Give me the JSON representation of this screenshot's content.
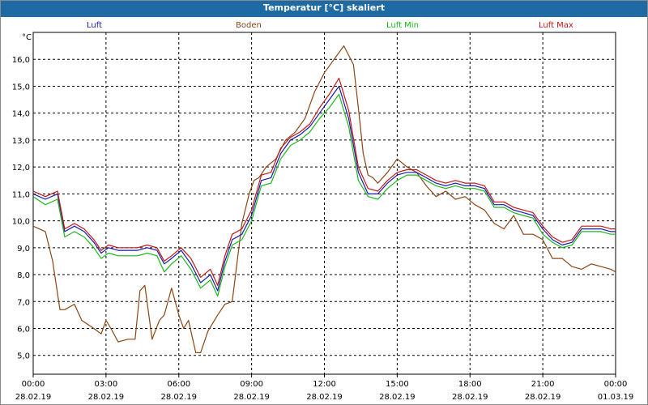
{
  "chart_data": {
    "type": "line",
    "title": "Temperatur [°C] skaliert",
    "ylabel": "°C",
    "ylim": [
      4.3,
      17.0
    ],
    "xlim": [
      0,
      24
    ],
    "grid": true,
    "legend_placement": "top",
    "y_ticks": [
      "5,0",
      "6,0",
      "7,0",
      "8,0",
      "9,0",
      "10,0",
      "11,0",
      "12,0",
      "13,0",
      "14,0",
      "15,0",
      "16,0"
    ],
    "x_ticks": [
      {
        "time": "00:00",
        "date": "28.02.19"
      },
      {
        "time": "03:00",
        "date": "28.02.19"
      },
      {
        "time": "06:00",
        "date": "28.02.19"
      },
      {
        "time": "09:00",
        "date": "28.02.19"
      },
      {
        "time": "12:00",
        "date": "28.02.19"
      },
      {
        "time": "15:00",
        "date": "28.02.19"
      },
      {
        "time": "18:00",
        "date": "28.02.19"
      },
      {
        "time": "21:00",
        "date": "28.02.19"
      },
      {
        "time": "00:00",
        "date": "01.03.19"
      }
    ],
    "series": [
      {
        "name": "Luft",
        "color": "#1a1aa8",
        "x": [
          0,
          0.5,
          1,
          1.3,
          1.7,
          2.1,
          2.5,
          2.8,
          3.1,
          3.5,
          3.9,
          4.3,
          4.7,
          5.1,
          5.4,
          5.7,
          6.1,
          6.5,
          6.9,
          7.3,
          7.6,
          7.9,
          8.2,
          8.6,
          9.0,
          9.4,
          9.8,
          10.2,
          10.6,
          11.0,
          11.4,
          11.8,
          12.2,
          12.6,
          13.0,
          13.4,
          13.8,
          14.2,
          14.6,
          15.0,
          15.4,
          15.8,
          16.2,
          16.6,
          17.0,
          17.4,
          17.8,
          18.2,
          18.6,
          19.0,
          19.4,
          19.8,
          20.2,
          20.6,
          21.0,
          21.4,
          21.8,
          22.2,
          22.6,
          23.0,
          23.4,
          23.8,
          24.0
        ],
        "y": [
          11.0,
          10.8,
          11.0,
          9.6,
          9.8,
          9.6,
          9.2,
          8.8,
          9.0,
          8.9,
          8.9,
          8.9,
          9.0,
          8.9,
          8.4,
          8.6,
          8.9,
          8.4,
          7.7,
          8.0,
          7.4,
          8.5,
          9.3,
          9.5,
          10.2,
          11.5,
          11.6,
          12.5,
          13.0,
          13.2,
          13.5,
          14.0,
          14.5,
          15.0,
          13.8,
          11.8,
          11.0,
          11.0,
          11.4,
          11.7,
          11.8,
          11.8,
          11.6,
          11.4,
          11.3,
          11.4,
          11.3,
          11.3,
          11.2,
          10.6,
          10.6,
          10.4,
          10.3,
          10.2,
          9.7,
          9.3,
          9.1,
          9.2,
          9.7,
          9.7,
          9.7,
          9.6,
          9.6
        ]
      },
      {
        "name": "Boden",
        "color": "#8b4513",
        "x": [
          0,
          0.5,
          0.8,
          1.1,
          1.3,
          1.7,
          2.0,
          2.5,
          2.8,
          3.0,
          3.2,
          3.5,
          3.9,
          4.2,
          4.4,
          4.6,
          4.9,
          5.2,
          5.4,
          5.7,
          6.0,
          6.2,
          6.4,
          6.7,
          6.9,
          7.2,
          7.6,
          7.9,
          8.2,
          8.6,
          8.9,
          9.1,
          9.3,
          9.6,
          10.0,
          10.4,
          10.8,
          11.2,
          11.6,
          12.0,
          12.4,
          12.8,
          13.2,
          13.4,
          13.6,
          13.8,
          14.0,
          14.2,
          14.6,
          15.0,
          15.4,
          15.8,
          16.2,
          16.6,
          17.0,
          17.4,
          17.8,
          18.2,
          18.6,
          19.0,
          19.4,
          19.8,
          20.2,
          20.6,
          21.0,
          21.4,
          21.8,
          22.2,
          22.6,
          23.0,
          23.4,
          23.8,
          24.0
        ],
        "y": [
          9.8,
          9.6,
          8.5,
          6.7,
          6.7,
          6.9,
          6.3,
          6.0,
          5.8,
          6.3,
          6.0,
          5.5,
          5.6,
          5.6,
          7.4,
          7.6,
          5.6,
          6.3,
          6.5,
          7.5,
          6.5,
          6.0,
          6.3,
          5.1,
          5.1,
          5.9,
          6.5,
          6.9,
          7.0,
          9.9,
          11.0,
          11.5,
          11.6,
          12.0,
          12.3,
          13.0,
          13.3,
          13.8,
          14.8,
          15.5,
          16.0,
          16.5,
          15.8,
          14.2,
          12.5,
          11.7,
          11.6,
          11.4,
          11.8,
          12.3,
          12.0,
          11.8,
          11.3,
          10.9,
          11.1,
          10.8,
          10.9,
          10.6,
          10.4,
          9.9,
          9.7,
          10.2,
          9.5,
          9.5,
          9.3,
          8.6,
          8.6,
          8.3,
          8.2,
          8.4,
          8.3,
          8.2,
          8.1
        ]
      },
      {
        "name": "Luft Min",
        "color": "#1ab81a",
        "x": [
          0,
          0.5,
          1,
          1.3,
          1.7,
          2.1,
          2.5,
          2.8,
          3.1,
          3.5,
          3.9,
          4.3,
          4.7,
          5.1,
          5.4,
          5.7,
          6.1,
          6.5,
          6.9,
          7.3,
          7.6,
          7.9,
          8.2,
          8.6,
          9.0,
          9.4,
          9.8,
          10.2,
          10.6,
          11.0,
          11.4,
          11.8,
          12.2,
          12.6,
          13.0,
          13.4,
          13.8,
          14.2,
          14.6,
          15.0,
          15.4,
          15.8,
          16.2,
          16.6,
          17.0,
          17.4,
          17.8,
          18.2,
          18.6,
          19.0,
          19.4,
          19.8,
          20.2,
          20.6,
          21.0,
          21.4,
          21.8,
          22.2,
          22.6,
          23.0,
          23.4,
          23.8,
          24.0
        ],
        "y": [
          10.9,
          10.6,
          10.8,
          9.4,
          9.6,
          9.4,
          9.0,
          8.6,
          8.8,
          8.7,
          8.7,
          8.7,
          8.8,
          8.7,
          8.1,
          8.4,
          8.7,
          8.2,
          7.5,
          7.8,
          7.2,
          8.3,
          9.1,
          9.3,
          10.0,
          11.3,
          11.4,
          12.3,
          12.8,
          13.0,
          13.3,
          13.8,
          14.2,
          14.7,
          13.5,
          11.5,
          10.9,
          10.8,
          11.2,
          11.5,
          11.7,
          11.7,
          11.5,
          11.3,
          11.2,
          11.3,
          11.2,
          11.2,
          11.1,
          10.5,
          10.5,
          10.3,
          10.2,
          10.1,
          9.5,
          9.2,
          9.0,
          9.1,
          9.6,
          9.6,
          9.6,
          9.5,
          9.5
        ]
      },
      {
        "name": "Luft Max",
        "color": "#c01818",
        "x": [
          0,
          0.5,
          1,
          1.3,
          1.7,
          2.1,
          2.5,
          2.8,
          3.1,
          3.5,
          3.9,
          4.3,
          4.7,
          5.1,
          5.4,
          5.7,
          6.1,
          6.5,
          6.9,
          7.3,
          7.6,
          7.9,
          8.2,
          8.6,
          9.0,
          9.4,
          9.8,
          10.2,
          10.6,
          11.0,
          11.4,
          11.8,
          12.2,
          12.6,
          13.0,
          13.4,
          13.8,
          14.2,
          14.6,
          15.0,
          15.4,
          15.8,
          16.2,
          16.6,
          17.0,
          17.4,
          17.8,
          18.2,
          18.6,
          19.0,
          19.4,
          19.8,
          20.2,
          20.6,
          21.0,
          21.4,
          21.8,
          22.2,
          22.6,
          23.0,
          23.4,
          23.8,
          24.0
        ],
        "y": [
          11.1,
          10.9,
          11.1,
          9.7,
          9.9,
          9.7,
          9.3,
          8.9,
          9.1,
          9.0,
          9.0,
          9.0,
          9.1,
          9.0,
          8.5,
          8.7,
          9.0,
          8.6,
          7.9,
          8.2,
          7.6,
          8.7,
          9.5,
          9.7,
          10.4,
          11.7,
          11.8,
          12.7,
          13.1,
          13.3,
          13.6,
          14.2,
          14.7,
          15.3,
          14.1,
          12.0,
          11.2,
          11.1,
          11.5,
          11.8,
          11.9,
          11.9,
          11.7,
          11.5,
          11.4,
          11.5,
          11.4,
          11.4,
          11.3,
          10.7,
          10.7,
          10.5,
          10.4,
          10.3,
          9.8,
          9.4,
          9.2,
          9.3,
          9.8,
          9.8,
          9.8,
          9.7,
          9.7
        ]
      }
    ]
  }
}
